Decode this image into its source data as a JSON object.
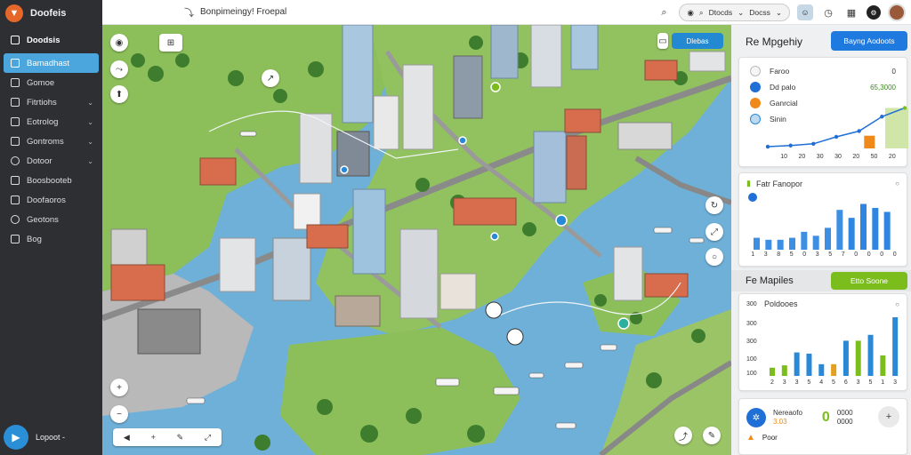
{
  "app": {
    "name": "Doofeis",
    "logo_glyph": "▼"
  },
  "topbar": {
    "breadcrumb": "Bonpimeingy! Froepal",
    "pill1_label": "Dtocds",
    "pill2_label": "Docss",
    "pill_chevron": "⌄"
  },
  "sidebar": {
    "header": "Doodsis",
    "items": [
      {
        "label": "Bamadhast",
        "active": true
      },
      {
        "label": "Gomoe"
      },
      {
        "label": "Fitrtiohs",
        "chevron": "⌄"
      },
      {
        "label": "Eotrolog",
        "chevron": "⌄"
      },
      {
        "label": "Gontroms",
        "chevron": "⌄"
      },
      {
        "label": "Dotoor",
        "chevron": "⌄"
      },
      {
        "label": "Boosbooteb"
      },
      {
        "label": "Doofaoros"
      },
      {
        "label": "Geotons"
      },
      {
        "label": "Bog"
      }
    ],
    "user_label": "Lopoot -"
  },
  "map": {
    "tag_label": "Dlebas",
    "toolbar": [
      "◀",
      "+",
      "✎",
      "⤢"
    ]
  },
  "panel": {
    "title": "Re Mpgehiy",
    "primary_button": "Bayng Aodoots",
    "card1": {
      "rows": [
        {
          "label": "Faroo",
          "value": "0",
          "color": "#f5f5f5"
        },
        {
          "label": "Dd palo",
          "value": "65,3000",
          "color": "#1f6fd6"
        },
        {
          "label": "Ganrcial",
          "value": "",
          "color": "#ef8a1a"
        },
        {
          "label": "Sinin",
          "value": "",
          "color": "#bcd9f0"
        }
      ],
      "axis": [
        "10",
        "20",
        "30",
        "30",
        "20",
        "50",
        "20"
      ]
    },
    "card2": {
      "title": "Fatr Fanopor",
      "axis": [
        "1",
        "3",
        "8",
        "5",
        "0",
        "3",
        "5",
        "7",
        "0",
        "0",
        "0",
        "0"
      ]
    },
    "section_title": "Fe Mapiles",
    "section_button": "Etto Soone",
    "card3": {
      "legend_title": "Poldooes",
      "y_labels": [
        "300",
        "300",
        "300",
        "100",
        "100"
      ],
      "axis": [
        "2",
        "3",
        "3",
        "5",
        "4",
        "5",
        "6",
        "3",
        "5",
        "1",
        "3"
      ]
    },
    "card4": {
      "title": "Nereaofo",
      "sub": "3.03",
      "zero": "0",
      "small1": "0000",
      "small2": "0000",
      "row2": "Poor"
    }
  },
  "chart_data": [
    {
      "type": "area",
      "title": "",
      "x": [
        "10",
        "20",
        "30",
        "30",
        "20",
        "50",
        "20"
      ],
      "series": [
        {
          "values": [
            3,
            5,
            8,
            20,
            30,
            55,
            70
          ]
        }
      ],
      "bars": [
        {
          "color": "#ef8a1a",
          "values": [
            0,
            0,
            0,
            0,
            0,
            22,
            35
          ]
        },
        {
          "color": "#cfe6a8",
          "values": [
            0,
            0,
            0,
            0,
            0,
            0,
            70
          ]
        }
      ]
    },
    {
      "type": "bar",
      "title": "",
      "categories": [
        "1",
        "3",
        "8",
        "5",
        "0",
        "3",
        "5",
        "7",
        "0",
        "0",
        "0",
        "0"
      ],
      "series": [
        {
          "values": [
            6,
            5,
            5,
            6,
            9,
            7,
            11,
            20,
            16,
            23,
            21,
            19
          ]
        }
      ]
    },
    {
      "type": "bar",
      "title": "",
      "categories": [
        "2",
        "3",
        "3",
        "5",
        "4",
        "5",
        "6",
        "3",
        "5",
        "1",
        "3"
      ],
      "series": [
        {
          "name": "",
          "values": [
            14,
            18,
            40,
            38,
            20,
            20,
            60,
            60,
            70,
            35,
            100
          ]
        }
      ],
      "colors": [
        "#7cbd1e",
        "#7cbd1e",
        "#2a89d6",
        "#2a89d6",
        "#2a89d6",
        "#e5a020",
        "#2a89d6",
        "#7cbd1e",
        "#2a89d6",
        "#7cbd1e",
        "#2a89d6"
      ]
    }
  ],
  "colors": {
    "accent": "#4aa6dd",
    "primary_button": "#1f7ae0",
    "green": "#7cbd1e",
    "sidebar_bg": "#2d2f33"
  }
}
